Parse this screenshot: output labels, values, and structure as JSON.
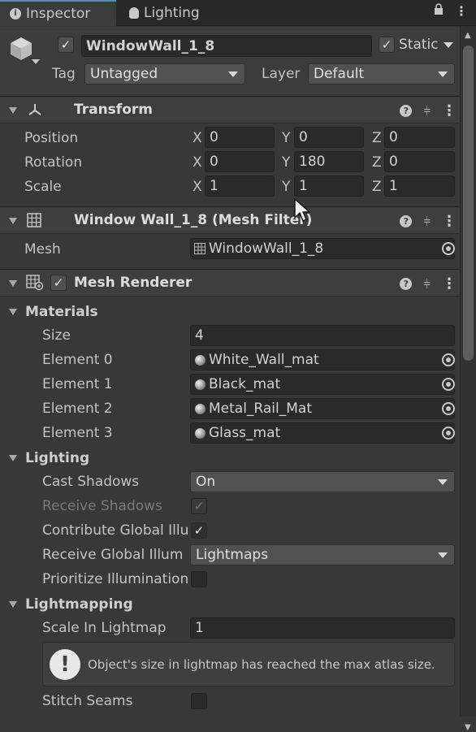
{
  "tabs": {
    "inspector": "Inspector",
    "lighting": "Lighting"
  },
  "object": {
    "name": "WindowWall_1_8",
    "static_label": "Static",
    "tag_label": "Tag",
    "tag_value": "Untagged",
    "layer_label": "Layer",
    "layer_value": "Default"
  },
  "transform": {
    "title": "Transform",
    "rows": [
      {
        "label": "Position",
        "x": "0",
        "y": "0",
        "z": "0"
      },
      {
        "label": "Rotation",
        "x": "0",
        "y": "180",
        "z": "0"
      },
      {
        "label": "Scale",
        "x": "1",
        "y": "1",
        "z": "1"
      }
    ],
    "axis": {
      "x": "X",
      "y": "Y",
      "z": "Z"
    }
  },
  "mesh_filter": {
    "title": "Window Wall_1_8 (Mesh Filter)",
    "mesh_label": "Mesh",
    "mesh_value": "WindowWall_1_8"
  },
  "mesh_renderer": {
    "title": "Mesh Renderer",
    "materials": {
      "title": "Materials",
      "size_label": "Size",
      "size_value": "4",
      "elements": [
        {
          "label": "Element 0",
          "value": "White_Wall_mat"
        },
        {
          "label": "Element 1",
          "value": "Black_mat"
        },
        {
          "label": "Element 2",
          "value": "Metal_Rail_Mat"
        },
        {
          "label": "Element 3",
          "value": "Glass_mat"
        }
      ]
    },
    "lighting": {
      "title": "Lighting",
      "cast_shadows_label": "Cast Shadows",
      "cast_shadows_value": "On",
      "receive_shadows_label": "Receive Shadows",
      "contribute_gi_label": "Contribute Global Illu",
      "receive_gi_label": "Receive Global Illum",
      "receive_gi_value": "Lightmaps",
      "prioritize_label": "Prioritize Illumination"
    },
    "lightmapping": {
      "title": "Lightmapping",
      "scale_label": "Scale In Lightmap",
      "scale_value": "1",
      "info": "Object's size in lightmap has reached the max atlas size.",
      "stitch_label": "Stitch Seams"
    }
  }
}
